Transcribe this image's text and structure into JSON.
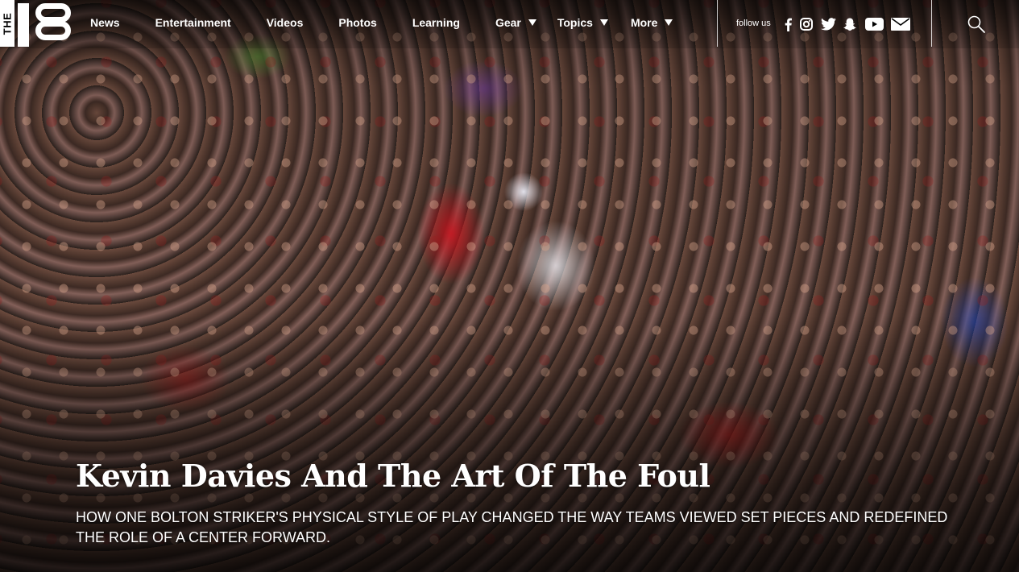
{
  "logo": {
    "the_text": "THE",
    "alt": "The 18"
  },
  "nav": {
    "items": [
      {
        "label": "News",
        "has_dropdown": false
      },
      {
        "label": "Entertainment",
        "has_dropdown": false
      },
      {
        "label": "Videos",
        "has_dropdown": false
      },
      {
        "label": "Photos",
        "has_dropdown": false
      },
      {
        "label": "Learning",
        "has_dropdown": false
      },
      {
        "label": "Gear",
        "has_dropdown": true
      },
      {
        "label": "Topics",
        "has_dropdown": true
      },
      {
        "label": "More",
        "has_dropdown": true
      }
    ]
  },
  "social": {
    "follow_label": "follow us",
    "icons": [
      "facebook-icon",
      "instagram-icon",
      "twitter-icon",
      "snapchat-icon",
      "youtube-icon",
      "mail-icon"
    ]
  },
  "search": {
    "icon": "search-icon"
  },
  "hero": {
    "title": "Kevin Davies And The Art Of The Foul",
    "subtitle": "HOW ONE BOLTON STRIKER'S PHYSICAL STYLE OF PLAY CHANGED THE WAY TEAMS VIEWED SET PIECES AND REDEFINED THE ROLE OF A CENTER FORWARD."
  },
  "colors": {
    "text": "#ffffff",
    "nav_caret": "#ffffff",
    "crowd_red": "#b81c22"
  }
}
